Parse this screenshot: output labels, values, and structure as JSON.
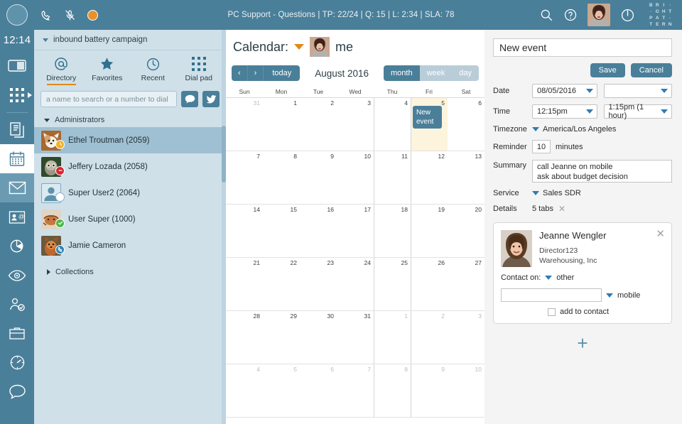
{
  "topbar": {
    "status_text": "PC Support - Questions | TP: 22/24  |  Q: 15 |  L: 2:34  |  SLA: 78",
    "icons": [
      "phone-icon",
      "mic-muted-icon",
      "status-dot-icon",
      "search-icon",
      "help-icon",
      "power-icon"
    ],
    "logo_cells": [
      "B",
      "R",
      "I",
      "·",
      "·",
      "G",
      "H",
      "T",
      "P",
      "A",
      "T",
      "·",
      "T",
      "E",
      "R",
      "N"
    ],
    "accent_color": "#4a7f99",
    "status_dot_color": "#e8912a"
  },
  "rail": {
    "time": "12:14",
    "items": [
      {
        "name": "toggle-panel-icon",
        "state": "normal"
      },
      {
        "name": "dial-pad-icon",
        "state": "normal"
      },
      {
        "name": "documents-icon",
        "state": "normal"
      },
      {
        "name": "calendar-icon",
        "state": "active"
      },
      {
        "name": "mail-icon",
        "state": "highlight"
      },
      {
        "name": "contacts-icon",
        "state": "normal"
      },
      {
        "name": "reports-icon",
        "state": "normal"
      },
      {
        "name": "monitor-icon",
        "state": "normal"
      },
      {
        "name": "agent-icon",
        "state": "normal"
      },
      {
        "name": "cases-icon",
        "state": "normal"
      },
      {
        "name": "dashboard-icon",
        "state": "normal"
      },
      {
        "name": "chat-icon",
        "state": "normal"
      }
    ]
  },
  "directory": {
    "campaign": "inbound battery campaign",
    "tabs": [
      {
        "label": "Directory",
        "icon": "at-icon",
        "selected": true
      },
      {
        "label": "Favorites",
        "icon": "star-icon",
        "selected": false
      },
      {
        "label": "Recent",
        "icon": "clock-icon",
        "selected": false
      },
      {
        "label": "Dial pad",
        "icon": "dialpad-icon",
        "selected": false
      }
    ],
    "search_placeholder": "a name to search or a number to dial",
    "search_value": "",
    "chat_button": "chat-icon",
    "twitter_button": "twitter-icon",
    "groups": [
      {
        "label": "Administrators",
        "expanded": true
      },
      {
        "label": "Collections",
        "expanded": false
      }
    ],
    "contacts": [
      {
        "name": "Ethel Troutman (2059)",
        "status": "away",
        "badge_color": "#f0b429",
        "badge_glyph": "◔",
        "selected": true,
        "avatar": "fox"
      },
      {
        "name": "Jeffery Lozada (2058)",
        "status": "busy",
        "badge_color": "#d8272c",
        "badge_glyph": "−",
        "selected": false,
        "avatar": "owl"
      },
      {
        "name": "Super User2 (2064)",
        "status": "offline",
        "badge_color": "#ffffff",
        "badge_glyph": "",
        "selected": false,
        "avatar": "placeholder"
      },
      {
        "name": "User Super (1000)",
        "status": "available",
        "badge_color": "#4eb849",
        "badge_glyph": "✓",
        "selected": false,
        "avatar": "crab"
      },
      {
        "name": "Jamie Cameron",
        "status": "on-call",
        "badge_color": "#2d83b5",
        "badge_glyph": "☎",
        "selected": false,
        "avatar": "squirrel"
      }
    ]
  },
  "calendar": {
    "title_prefix": "Calendar:",
    "owner": "me",
    "prev_label": "‹",
    "next_label": "›",
    "today_label": "today",
    "month_label": "August 2016",
    "views": [
      {
        "label": "month",
        "active": true
      },
      {
        "label": "week",
        "active": false
      },
      {
        "label": "day",
        "active": false
      }
    ],
    "weekdays": [
      "Sun",
      "Mon",
      "Tue",
      "Wed",
      "Thu",
      "Fri",
      "Sat"
    ],
    "weeks": [
      [
        {
          "d": "31",
          "other": true
        },
        {
          "d": "1"
        },
        {
          "d": "2"
        },
        {
          "d": "3"
        },
        {
          "d": "4"
        },
        {
          "d": "5",
          "highlight": true,
          "event": "New event"
        },
        {
          "d": "6"
        }
      ],
      [
        {
          "d": "7"
        },
        {
          "d": "8"
        },
        {
          "d": "9"
        },
        {
          "d": "10"
        },
        {
          "d": "11"
        },
        {
          "d": "12"
        },
        {
          "d": "13"
        }
      ],
      [
        {
          "d": "14"
        },
        {
          "d": "15"
        },
        {
          "d": "16"
        },
        {
          "d": "17"
        },
        {
          "d": "18"
        },
        {
          "d": "19"
        },
        {
          "d": "20"
        }
      ],
      [
        {
          "d": "21"
        },
        {
          "d": "22"
        },
        {
          "d": "23"
        },
        {
          "d": "24"
        },
        {
          "d": "25"
        },
        {
          "d": "26"
        },
        {
          "d": "27"
        }
      ],
      [
        {
          "d": "28"
        },
        {
          "d": "29"
        },
        {
          "d": "30"
        },
        {
          "d": "31"
        },
        {
          "d": "1",
          "other": true
        },
        {
          "d": "2",
          "other": true
        },
        {
          "d": "3",
          "other": true
        }
      ],
      [
        {
          "d": "4",
          "other": true
        },
        {
          "d": "5",
          "other": true
        },
        {
          "d": "6",
          "other": true
        },
        {
          "d": "7",
          "other": true
        },
        {
          "d": "8",
          "other": true
        },
        {
          "d": "9",
          "other": true
        },
        {
          "d": "10",
          "other": true
        }
      ]
    ]
  },
  "event_form": {
    "title_value": "New event",
    "save_label": "Save",
    "cancel_label": "Cancel",
    "date_label": "Date",
    "date_value": "08/05/2016",
    "date_end_value": "",
    "time_label": "Time",
    "time_start_value": "12:15pm",
    "time_end_value": "1:15pm (1 hour)",
    "timezone_label": "Timezone",
    "timezone_value": "America/Los Angeles",
    "reminder_label": "Reminder",
    "reminder_value": "10",
    "reminder_unit": "minutes",
    "summary_label": "Summary",
    "summary_value": "call Jeanne on mobile\nask about budget decision",
    "service_label": "Service",
    "service_value": "Sales SDR",
    "details_label": "Details",
    "details_value": "5 tabs",
    "details_close": "✕"
  },
  "contact_card": {
    "name": "Jeanne Wengler",
    "job_title": "Director123",
    "company": "Warehousing, Inc",
    "contact_on_label": "Contact on:",
    "contact_on_value": "other",
    "phone_value": "",
    "phone_type": "mobile",
    "add_contact_label": "add to contact",
    "add_contact_checked": false,
    "close_label": "✕",
    "add_more_label": "+"
  }
}
